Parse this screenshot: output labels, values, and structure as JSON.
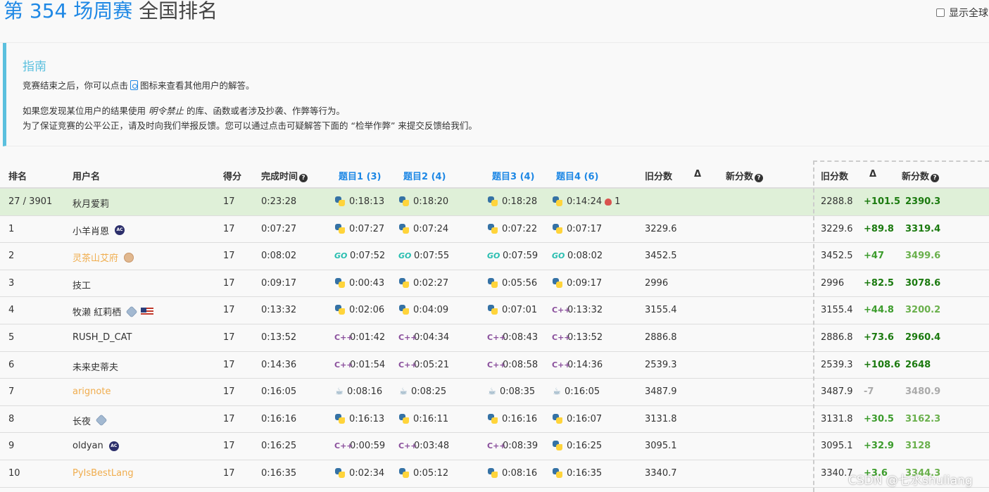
{
  "header": {
    "contest": "第 354 场周赛",
    "subtitle": "全国排名",
    "show_global_label": "显示全球"
  },
  "guide": {
    "title": "指南",
    "line1_pre": "竞赛结束之后，你可以点击",
    "line1_post": "图标来查看其他用户的解答。",
    "line2_pre": "如果您发现某位用户的结果使用",
    "line2_em": "明令禁止",
    "line2_post": "的库、函数或者涉及抄袭、作弊等行为。",
    "line3": "为了保证竞赛的公平公正，请及时向我们举报反馈。您可以通过点击可疑解答下面的 “检举作弊” 来提交反馈给我们。"
  },
  "table": {
    "headers": {
      "rank": "排名",
      "user": "用户名",
      "score": "得分",
      "finish": "完成时间",
      "q1": "题目1 (3)",
      "q2": "题目2 (4)",
      "q3": "题目3 (4)",
      "q4": "题目4 (6)",
      "old": "旧分数",
      "delta": "Δ",
      "new": "新分数",
      "old2": "旧分数",
      "delta2": "Δ",
      "new2": "新分数"
    },
    "me": {
      "rank": "27 / 3901",
      "user": "秋月爱莉",
      "score": "17",
      "finish": "0:23:28",
      "q": [
        {
          "lang": "python",
          "t": "0:18:13"
        },
        {
          "lang": "python",
          "t": "0:18:20"
        },
        {
          "lang": "python",
          "t": "0:18:28"
        },
        {
          "lang": "python",
          "t": "0:14:24"
        }
      ],
      "wrong": "1",
      "old2": "2288.8",
      "delta2": "+101.5",
      "new2": "2390.3"
    },
    "rows": [
      {
        "rank": "1",
        "user": "小羊肖恩",
        "badge": "ac",
        "score": "17",
        "finish": "0:07:27",
        "q": [
          {
            "lang": "python",
            "t": "0:07:27"
          },
          {
            "lang": "python",
            "t": "0:07:24"
          },
          {
            "lang": "python",
            "t": "0:07:22"
          },
          {
            "lang": "python",
            "t": "0:07:17"
          }
        ],
        "old": "3229.6",
        "old2": "3229.6",
        "delta2": "+89.8",
        "new2": "3319.4",
        "style": "dark"
      },
      {
        "rank": "2",
        "user": "灵茶山艾府",
        "badge": "avatar",
        "orange": true,
        "score": "17",
        "finish": "0:08:02",
        "q": [
          {
            "lang": "go",
            "t": "0:07:52"
          },
          {
            "lang": "go",
            "t": "0:07:55"
          },
          {
            "lang": "go",
            "t": "0:07:59"
          },
          {
            "lang": "go",
            "t": "0:08:02"
          }
        ],
        "old": "3452.5",
        "old2": "3452.5",
        "delta2": "+47",
        "new2": "3499.6",
        "style": "light"
      },
      {
        "rank": "3",
        "user": "技工",
        "score": "17",
        "finish": "0:09:17",
        "q": [
          {
            "lang": "python",
            "t": "0:00:43"
          },
          {
            "lang": "python",
            "t": "0:02:27"
          },
          {
            "lang": "python",
            "t": "0:05:56"
          },
          {
            "lang": "python",
            "t": "0:09:17"
          }
        ],
        "old": "2996",
        "old2": "2996",
        "delta2": "+82.5",
        "new2": "3078.6",
        "style": "dark"
      },
      {
        "rank": "4",
        "user": "牧濑 紅莉栖",
        "badge": "guardian",
        "flag": true,
        "score": "17",
        "finish": "0:13:32",
        "q": [
          {
            "lang": "python",
            "t": "0:02:06"
          },
          {
            "lang": "python",
            "t": "0:04:09"
          },
          {
            "lang": "python",
            "t": "0:07:01"
          },
          {
            "lang": "cpp",
            "t": "0:13:32"
          }
        ],
        "old": "3155.4",
        "old2": "3155.4",
        "delta2": "+44.8",
        "new2": "3200.2",
        "style": "light"
      },
      {
        "rank": "5",
        "user": "RUSH_D_CAT",
        "score": "17",
        "finish": "0:13:52",
        "q": [
          {
            "lang": "cpp",
            "t": "0:01:42"
          },
          {
            "lang": "cpp",
            "t": "0:04:34"
          },
          {
            "lang": "cpp",
            "t": "0:08:43"
          },
          {
            "lang": "cpp",
            "t": "0:13:52"
          }
        ],
        "old": "2886.8",
        "old2": "2886.8",
        "delta2": "+73.6",
        "new2": "2960.4",
        "style": "dark"
      },
      {
        "rank": "6",
        "user": "未来史蒂夫",
        "score": "17",
        "finish": "0:14:36",
        "q": [
          {
            "lang": "cpp",
            "t": "0:01:54"
          },
          {
            "lang": "cpp",
            "t": "0:05:21"
          },
          {
            "lang": "cpp",
            "t": "0:08:58"
          },
          {
            "lang": "cpp",
            "t": "0:14:36"
          }
        ],
        "old": "2539.3",
        "old2": "2539.3",
        "delta2": "+108.6",
        "new2": "2648",
        "style": "dark"
      },
      {
        "rank": "7",
        "user": "arignote",
        "orange": true,
        "score": "17",
        "finish": "0:16:05",
        "q": [
          {
            "lang": "java",
            "t": "0:08:16"
          },
          {
            "lang": "java",
            "t": "0:08:25"
          },
          {
            "lang": "java",
            "t": "0:08:35"
          },
          {
            "lang": "java",
            "t": "0:16:05"
          }
        ],
        "old": "3487.9",
        "old2": "3487.9",
        "delta2": "-7",
        "new2": "3480.9",
        "style": "neg"
      },
      {
        "rank": "8",
        "user": "长夜",
        "badge": "guardian",
        "score": "17",
        "finish": "0:16:16",
        "q": [
          {
            "lang": "python",
            "t": "0:16:13"
          },
          {
            "lang": "python",
            "t": "0:16:11"
          },
          {
            "lang": "python",
            "t": "0:16:16"
          },
          {
            "lang": "python",
            "t": "0:16:07"
          }
        ],
        "old": "3131.8",
        "old2": "3131.8",
        "delta2": "+30.5",
        "new2": "3162.3",
        "style": "light"
      },
      {
        "rank": "9",
        "user": "oldyan",
        "badge": "ac",
        "score": "17",
        "finish": "0:16:25",
        "q": [
          {
            "lang": "cpp",
            "t": "0:00:59"
          },
          {
            "lang": "cpp",
            "t": "0:03:48"
          },
          {
            "lang": "cpp",
            "t": "0:08:39"
          },
          {
            "lang": "python",
            "t": "0:16:25"
          }
        ],
        "old": "3095.1",
        "old2": "3095.1",
        "delta2": "+32.9",
        "new2": "3128",
        "style": "light"
      },
      {
        "rank": "10",
        "user": "PyIsBestLang",
        "orange": true,
        "score": "17",
        "finish": "0:16:35",
        "q": [
          {
            "lang": "python",
            "t": "0:02:34"
          },
          {
            "lang": "python",
            "t": "0:05:12"
          },
          {
            "lang": "python",
            "t": "0:08:16"
          },
          {
            "lang": "python",
            "t": "0:16:35"
          }
        ],
        "old": "3340.7",
        "old2": "3340.7",
        "delta2": "+3.6",
        "new2": "3344.3",
        "style": "light"
      }
    ]
  },
  "watermark": "CSDN @七水shuliang"
}
